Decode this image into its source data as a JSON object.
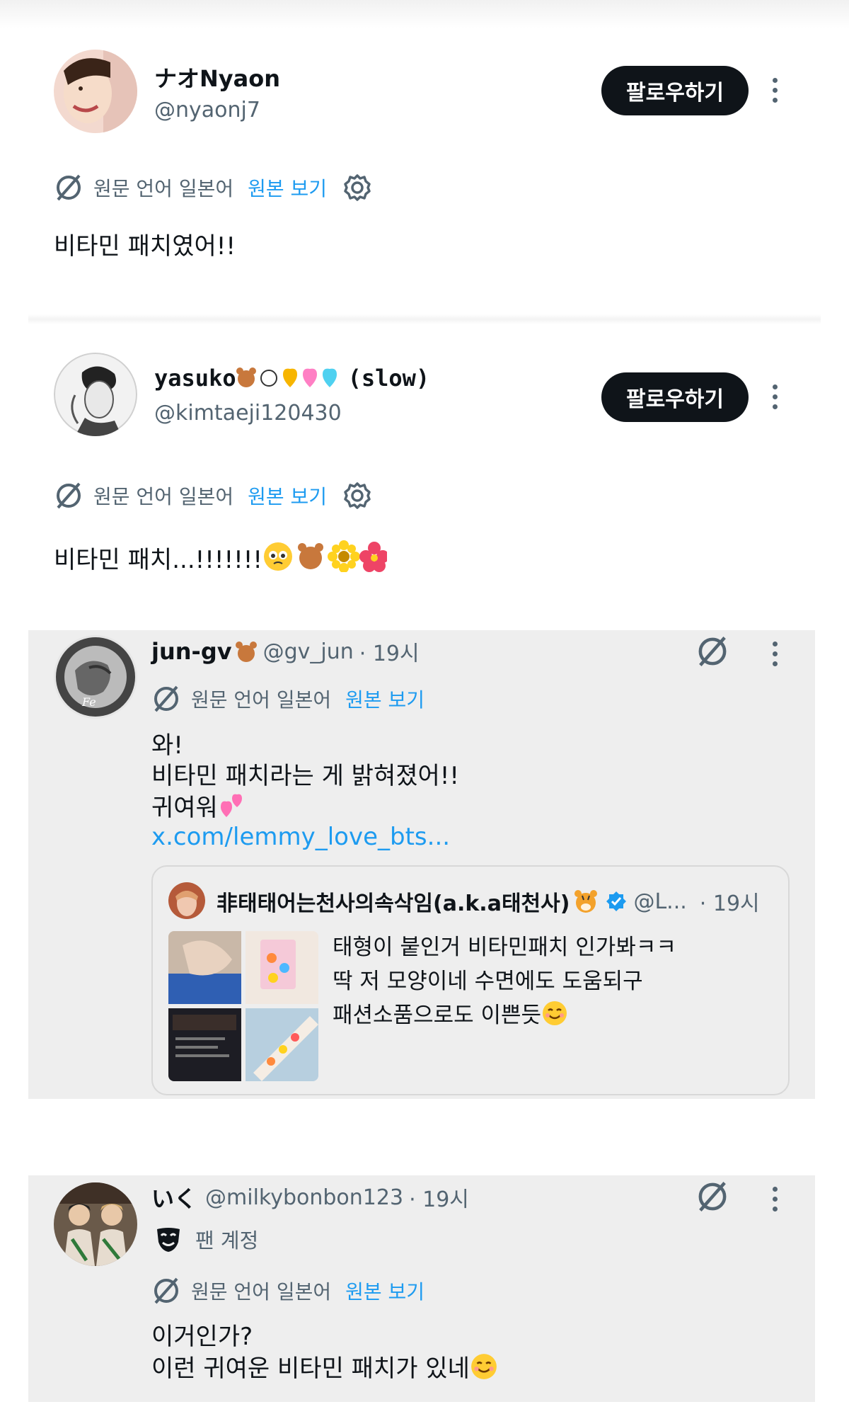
{
  "posts": [
    {
      "name": "ナオNyaon",
      "handle": "@nyaonj7",
      "follow_label": "팔로우하기",
      "translation": {
        "label": "원문 언어 일본어",
        "link": "원본 보기"
      },
      "text": "비타민 패치였어!!"
    },
    {
      "name": "yasuko",
      "name_suffix": "(slow)",
      "handle": "@kimtaeji120430",
      "follow_label": "팔로우하기",
      "translation": {
        "label": "원문 언어 일본어",
        "link": "원본 보기"
      },
      "text": "비타민 패치...!!!!!!!"
    },
    {
      "name": "jun-gv",
      "handle": "@gv_jun",
      "time": "· 19시",
      "translation": {
        "label": "원문 언어 일본어",
        "link": "원본 보기"
      },
      "lines": [
        "와!",
        "비타민 패치라는 게 밝혀졌어!!",
        "귀여워"
      ],
      "link_text": "x.com/lemmy_love_bts...",
      "quote": {
        "name": "非태태어는천사의속삭임(a.k.a태천사)",
        "handle": "@L...",
        "time": "· 19시",
        "lines": [
          "태형이 붙인거 비타민패치 인가봐ㅋㅋ",
          "딱 저 모양이네 수면에도 도움되구",
          "패션소품으로도 이쁜듯"
        ]
      }
    },
    {
      "name": "いく",
      "handle": "@milkybonbon123",
      "time": "· 19시",
      "badge": "팬 계정",
      "translation": {
        "label": "원문 언어 일본어",
        "link": "원본 보기"
      },
      "lines": [
        "이거인가?",
        "이런 귀여운 비타민 패치가 있네"
      ]
    }
  ],
  "icons": {
    "translate": "translate-icon",
    "settings": "gear-icon",
    "more": "more-icon",
    "verified": "verified-badge-icon",
    "fan_account": "mask-icon"
  },
  "colors": {
    "link": "#1d9bf0",
    "button": "#0f1419",
    "muted": "#536471",
    "card": "#eeeeee"
  }
}
